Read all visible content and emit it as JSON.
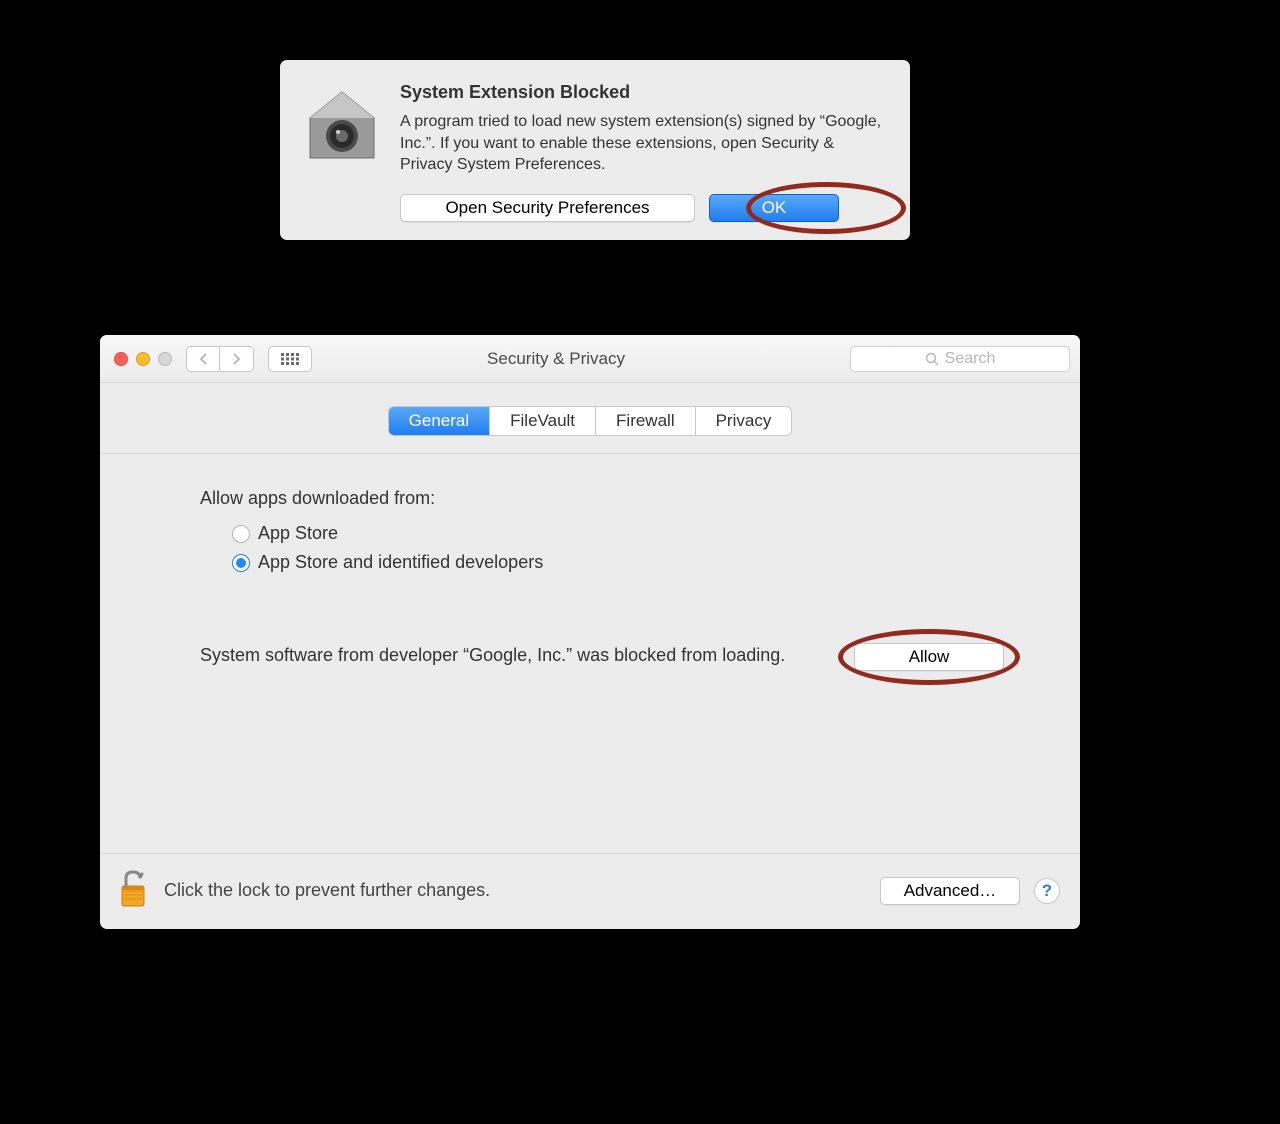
{
  "alert": {
    "title": "System Extension Blocked",
    "message": "A program tried to load new system extension(s) signed by “Google, Inc.”.  If you want to enable these extensions, open Security & Privacy System Preferences.",
    "open_button": "Open Security Preferences",
    "ok_button": "OK"
  },
  "prefs": {
    "window_title": "Security & Privacy",
    "search_placeholder": "Search",
    "tabs": {
      "general": "General",
      "filevault": "FileVault",
      "firewall": "Firewall",
      "privacy": "Privacy"
    },
    "allow_apps_label": "Allow apps downloaded from:",
    "radio_appstore": "App Store",
    "radio_identified": "App Store and identified developers",
    "blocked_message": "System software from developer “Google, Inc.” was blocked from loading.",
    "allow_button": "Allow",
    "lock_text": "Click the lock to prevent further changes.",
    "advanced_button": "Advanced…",
    "help_label": "?"
  }
}
